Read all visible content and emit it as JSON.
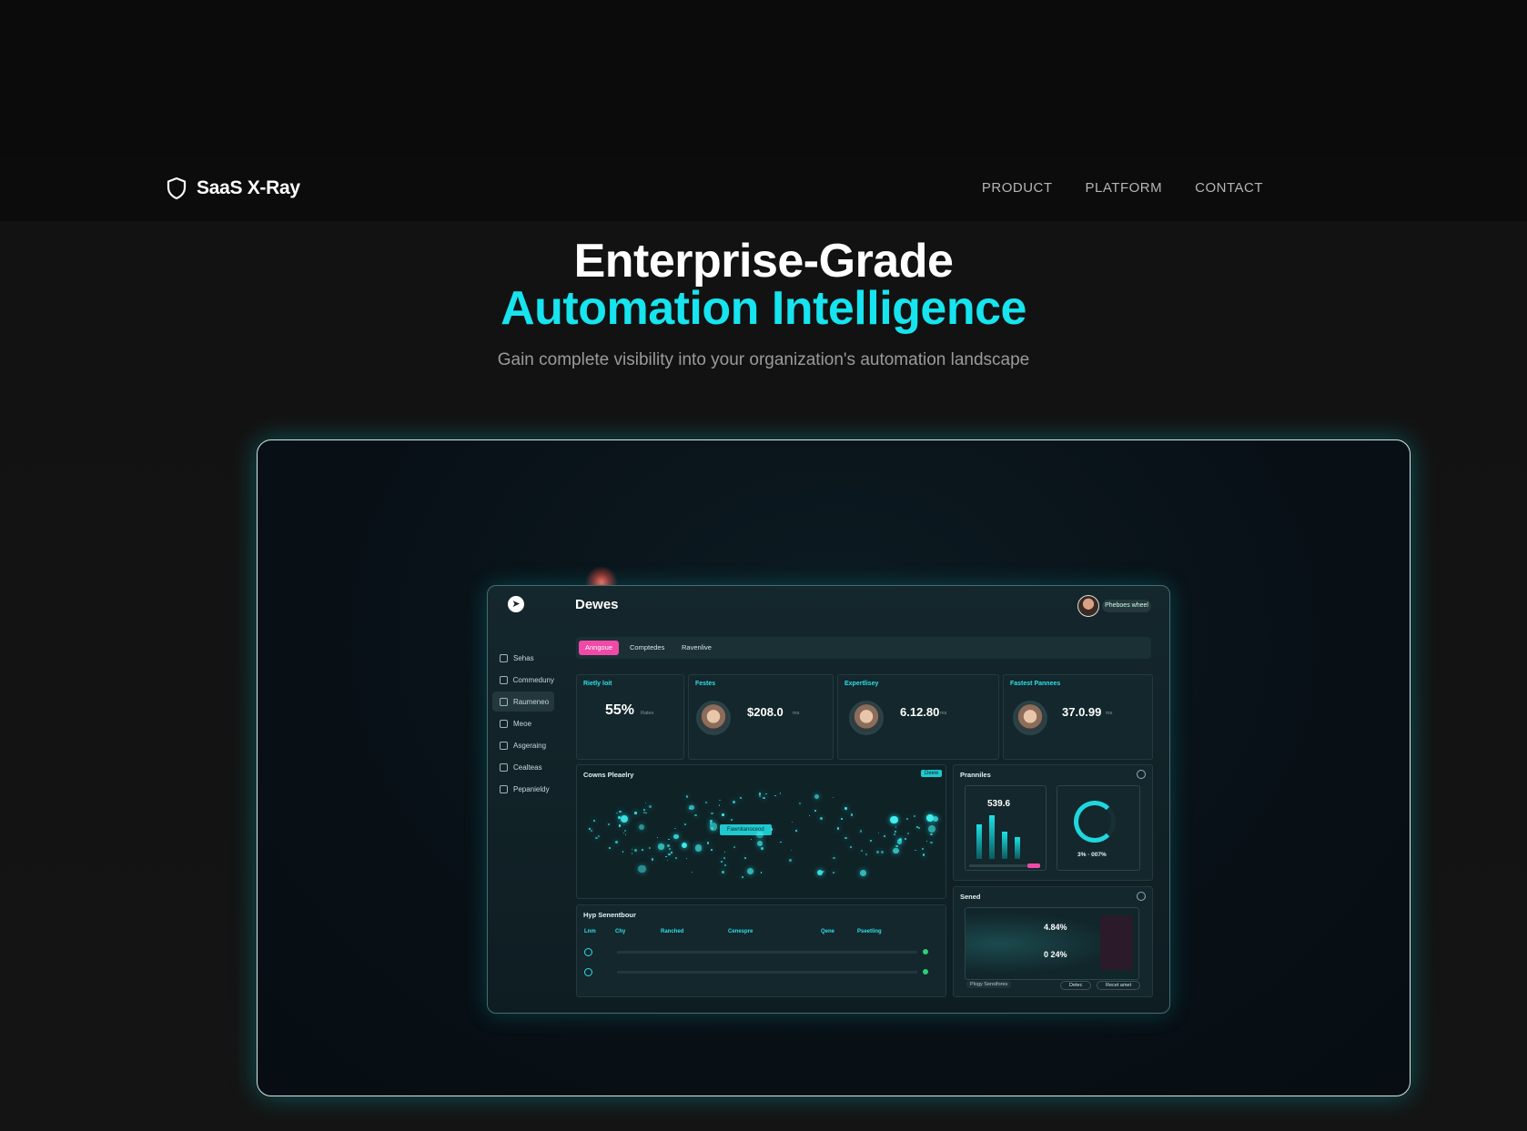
{
  "brand": {
    "name": "SaaS X-Ray",
    "logo_icon": "shield-icon"
  },
  "nav": {
    "items": [
      "PRODUCT",
      "PLATFORM",
      "CONTACT"
    ]
  },
  "hero": {
    "title_line1": "Enterprise-Grade",
    "title_line2": "Automation Intelligence",
    "subtitle": "Gain complete visibility into your organization's automation landscape"
  },
  "colors": {
    "accent": "#16e4ef",
    "highlight": "#f04aa8",
    "background": "#0b0b0b"
  },
  "dashboard": {
    "title": "Dewes",
    "user_chip": "Pheboes wheel",
    "sidebar": [
      "Sehas",
      "Commeduny",
      "Raumeneo",
      "Meoe",
      "Asgeraing",
      "Cealteas",
      "Pepanieldy"
    ],
    "sidebar_active_index": 2,
    "tabs": [
      "Anngoue",
      "Comptedes",
      "Ravenlive"
    ],
    "tab_active_index": 0,
    "kpis": [
      {
        "label": "Rietly loit",
        "value": "55%",
        "unit": "Rates"
      },
      {
        "label": "Festes",
        "value": "$208.0",
        "unit": "ms"
      },
      {
        "label": "Expertlisey",
        "value": "6.12.80",
        "unit": "ms"
      },
      {
        "label": "Fastest Pannees",
        "value": "37.0.99",
        "unit": "ms"
      }
    ],
    "map_panel": {
      "title": "Cowns Pleaelry",
      "chip": "Deew",
      "center_label": "Fawnitanoceod"
    },
    "right_top": {
      "title": "Pranniles",
      "value": "539.6",
      "donut_text": "3% · 007%"
    },
    "table": {
      "title": "Hyp Senentbour",
      "headers": [
        "Lnm",
        "Chy",
        "Ranched",
        "Cenespre",
        "Qene",
        "Pseetling"
      ]
    },
    "right_bottom": {
      "title": "Sened",
      "values": [
        "4.84%",
        "0 24%"
      ],
      "buttons": [
        "Plogy Sensifores",
        "Detec",
        "Recet amet"
      ]
    }
  }
}
